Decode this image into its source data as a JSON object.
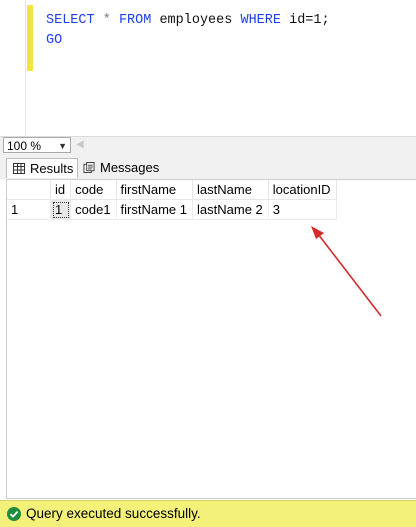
{
  "editor": {
    "line1": {
      "kw1": "SELECT",
      "star": "*",
      "kw2": "FROM",
      "table": "employees",
      "kw3": "WHERE",
      "cond": "id=1;"
    },
    "line2": {
      "kw": "GO"
    }
  },
  "zoom": {
    "value": "100 %"
  },
  "tabs": [
    {
      "label": "Results",
      "active": true
    },
    {
      "label": "Messages",
      "active": false
    }
  ],
  "results": {
    "columns": [
      "id",
      "code",
      "firstName",
      "lastName",
      "locationID"
    ],
    "rows": [
      {
        "rownum": "1",
        "cells": [
          "1",
          "code1",
          "firstName 1",
          "lastName 2",
          "3"
        ]
      }
    ]
  },
  "status": {
    "text": "Query executed successfully.",
    "color": "#1e8e3e"
  },
  "colors": {
    "status_bg": "#f4f17a",
    "annotation_arrow": "#d42b2b",
    "keyword": "#1f3ff0",
    "change_bar": "#f1e542"
  }
}
